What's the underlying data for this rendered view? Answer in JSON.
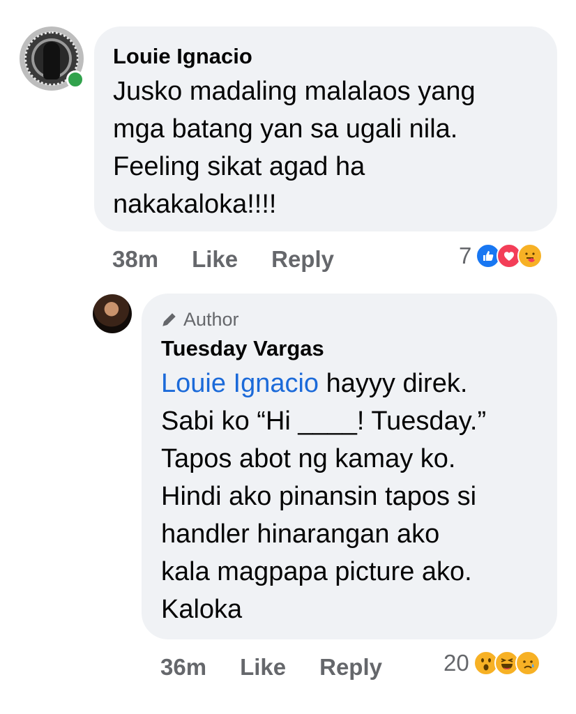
{
  "comment": {
    "author": "Louie Ignacio",
    "text": "Jusko madaling malalaos yang mga batang yan sa ugali nila. Feeling sikat agad ha nakakaloka!!!!",
    "time": "38m",
    "like_label": "Like",
    "reply_label": "Reply",
    "reaction_count": "7",
    "reactions": [
      "like-icon",
      "love-icon",
      "care-icon"
    ]
  },
  "reply": {
    "badge": "Author",
    "author": "Tuesday Vargas",
    "mention": "Louie Ignacio",
    "text_lines": [
      "hayyy direk.",
      "Sabi ko “Hi ____! Tuesday.”",
      "Tapos abot ng kamay ko.",
      "Hindi ako pinansin tapos si",
      "handler hinarangan ako",
      "kala magpapa picture ako.",
      "Kaloka"
    ],
    "time": "36m",
    "like_label": "Like",
    "reply_label": "Reply",
    "reaction_count": "20",
    "reactions": [
      "wow-icon",
      "haha-icon",
      "sad-icon"
    ]
  },
  "colors": {
    "bubble": "#f0f2f5",
    "mention": "#1b6ad9",
    "secondary_text": "#65676b",
    "online": "#31a24c"
  }
}
